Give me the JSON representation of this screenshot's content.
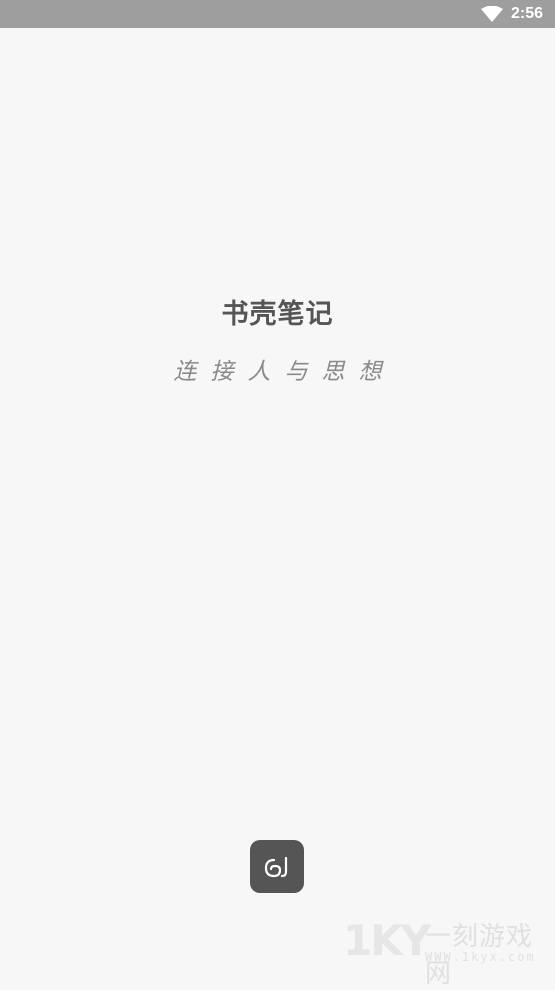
{
  "status_bar": {
    "time": "2:56",
    "wifi_icon": "wifi-icon"
  },
  "splash": {
    "title": "书壳笔记",
    "slogan": "连接人与思想",
    "logo_icon": "app-logo-icon"
  },
  "watermark": {
    "logo_text": "1KY",
    "name": "一刻游戏网",
    "url": "WWW.1kyx.com"
  },
  "colors": {
    "background": "#f7f7f7",
    "status_bar": "#9e9e9e",
    "title": "#555555",
    "slogan": "#8a8a8a",
    "logo_bg": "#555555"
  }
}
